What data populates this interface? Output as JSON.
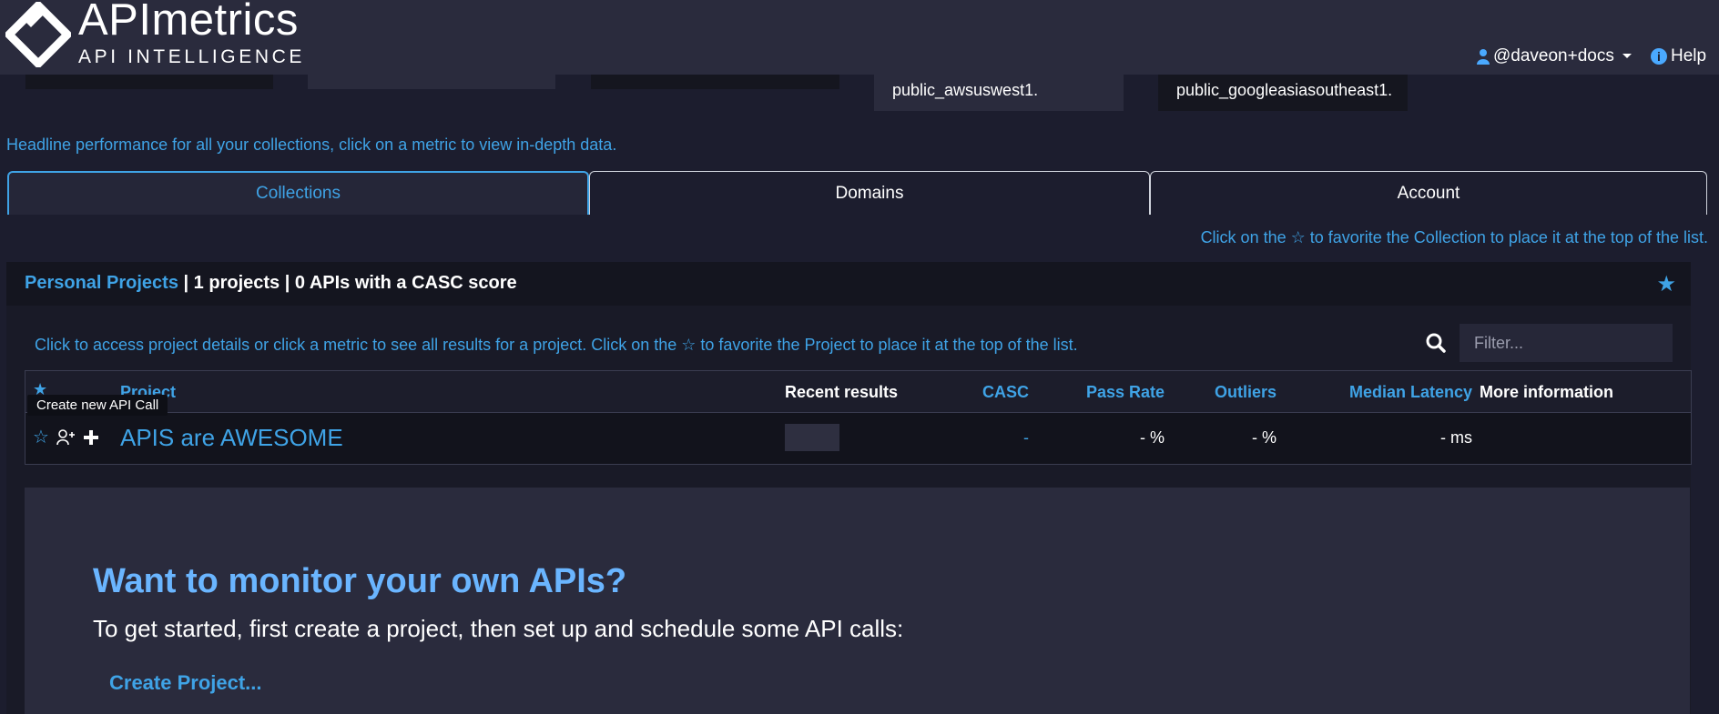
{
  "header": {
    "logo_title": "APImetrics",
    "logo_subtitle": "API INTELLIGENCE",
    "user_label": "@daveon+docs",
    "help_label": "Help"
  },
  "server_cards": {
    "awsuswest": "public_awsuswest1.",
    "googleasia": "public_googleasiasoutheast1."
  },
  "headline": "Headline performance for all your collections, click on a metric to view in-depth data.",
  "tabs": [
    {
      "label": "Collections",
      "active": true
    },
    {
      "label": "Domains",
      "active": false
    },
    {
      "label": "Account",
      "active": false
    }
  ],
  "favorite_hint": "Click on the ☆ to favorite the Collection to place it at the top of the list.",
  "collection": {
    "name": "Personal Projects",
    "project_count": "| 1 projects |",
    "casc_count": "0 APIs with a CASC score"
  },
  "project_hint": "Click to access project details or click a metric to see all results for a project. Click on the ☆ to favorite the Project to place it at the top of the list.",
  "filter": {
    "placeholder": "Filter..."
  },
  "table": {
    "headers": {
      "project": "Project",
      "recent": "Recent results",
      "casc": "CASC",
      "pass_rate": "Pass Rate",
      "outliers": "Outliers",
      "median_latency": "Median Latency",
      "more_info": "More information"
    },
    "tooltip": "Create new API Call",
    "rows": [
      {
        "name": "APIS are AWESOME",
        "casc": "-",
        "pass_rate": "- %",
        "outliers": "- %",
        "median_latency": "- ms"
      }
    ]
  },
  "promo": {
    "title": "Want to monitor your own APIs?",
    "text": "To get started, first create a project, then set up and schedule some API calls:",
    "button": "Create Project..."
  },
  "colors": {
    "accent": "#3fa3e6",
    "background": "#1c1d2e",
    "header": "#2a2b3d"
  }
}
